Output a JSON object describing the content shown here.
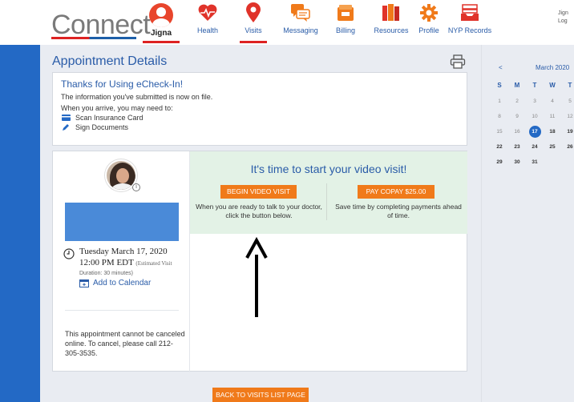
{
  "header": {
    "logo": "Connect",
    "user_name": "Jigna",
    "nav": [
      {
        "label": "Health",
        "icon": "heart-pulse-icon"
      },
      {
        "label": "Visits",
        "icon": "map-pin-icon"
      },
      {
        "label": "Messaging",
        "icon": "chat-bubbles-icon"
      },
      {
        "label": "Billing",
        "icon": "wallet-icon"
      },
      {
        "label": "Resources",
        "icon": "book-icon"
      },
      {
        "label": "Profile",
        "icon": "gear-icon"
      },
      {
        "label": "NYP Records",
        "icon": "inbox-tray-icon"
      }
    ],
    "account_line1": "Jign",
    "account_line2": "Log"
  },
  "main": {
    "title": "Appointment Details",
    "thanks": {
      "title": "Thanks for Using eCheck-In!",
      "line1": "The information you've submitted is now on file.",
      "line2": "When you arrive, you may need to:",
      "item1": "Scan Insurance Card",
      "item2": "Sign Documents"
    },
    "appointment": {
      "date": "Tuesday March 17, 2020",
      "time": "12:00 PM EDT",
      "time_note": "(Estimated Visit",
      "duration": "Duration: 30 minutes)",
      "add_calendar": "Add to Calendar",
      "cancel_note": "This appointment cannot be canceled online. To cancel, please call 212-305-3535."
    },
    "video": {
      "title": "It's time to start your video visit!",
      "begin_button": "BEGIN VIDEO VISIT",
      "copay_button": "PAY COPAY $25.00",
      "begin_desc": "When you are ready to talk to your doctor, click the button below.",
      "copay_desc": "Save time by completing payments ahead of time."
    },
    "back_button": "BACK TO VISITS LIST PAGE"
  },
  "calendar": {
    "prev": "<",
    "month": "March 2020",
    "dows": [
      "S",
      "M",
      "T",
      "W",
      "T"
    ],
    "weeks": [
      [
        "1",
        "2",
        "3",
        "4",
        "5"
      ],
      [
        "8",
        "9",
        "10",
        "11",
        "12"
      ],
      [
        "15",
        "16",
        "17",
        "18",
        "19"
      ],
      [
        "22",
        "23",
        "24",
        "25",
        "26"
      ],
      [
        "29",
        "30",
        "31"
      ]
    ],
    "selected": "17"
  },
  "colors": {
    "brand_blue": "#2369c5",
    "accent_red": "#dd2222",
    "button_orange": "#f07a1a",
    "video_panel_green": "#e3f2e6"
  }
}
